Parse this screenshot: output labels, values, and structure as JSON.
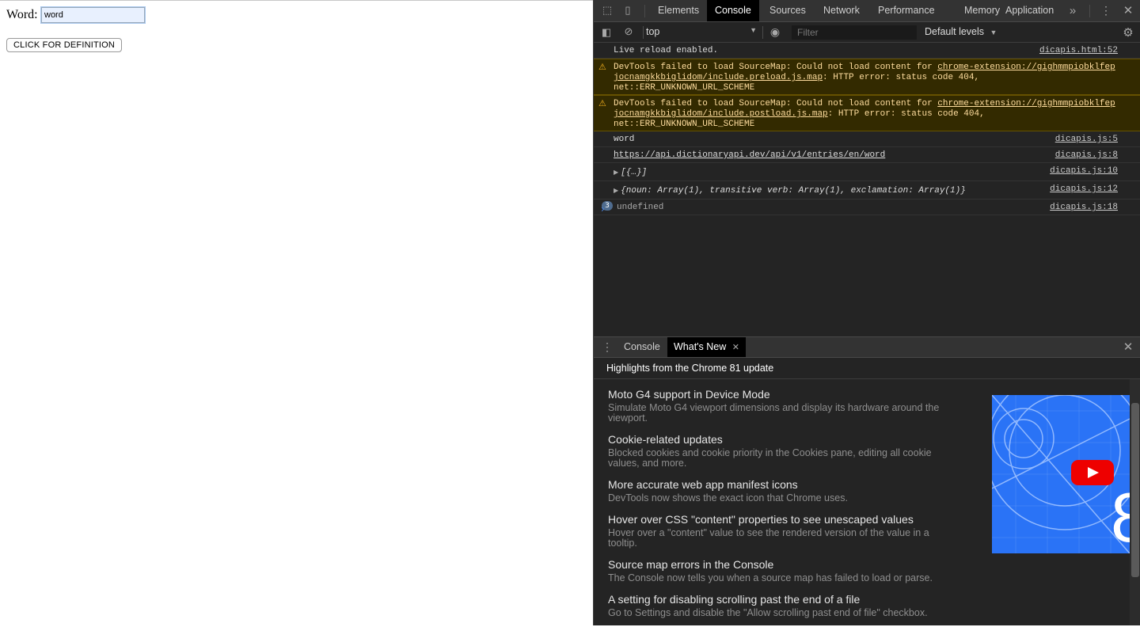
{
  "page": {
    "word_label": "Word:",
    "word_value": "word",
    "button_label": "CLICK FOR DEFINITION"
  },
  "devtools": {
    "tabs": [
      "Elements",
      "Console",
      "Sources",
      "Network",
      "Performance",
      "Memory",
      "Application"
    ],
    "active_tab": "Console",
    "context": "top",
    "filter_placeholder": "Filter",
    "levels": "Default levels",
    "messages": [
      {
        "text": "Live reload enabled.",
        "source": "dicapis.html:52"
      },
      {
        "warn_pre": "DevTools failed to load SourceMap: Could not load content for ",
        "warn_link": "chrome-extension://gighmmpiobklfepjocnamgkkbiglidom/include.preload.js.map",
        "warn_post": ": HTTP error: status code 404, net::ERR_UNKNOWN_URL_SCHEME"
      },
      {
        "warn_pre": "DevTools failed to load SourceMap: Could not load content for ",
        "warn_link": "chrome-extension://gighmmpiobklfepjocnamgkkbiglidom/include.postload.js.map",
        "warn_post": ": HTTP error: status code 404, net::ERR_UNKNOWN_URL_SCHEME"
      },
      {
        "text": "word",
        "source": "dicapis.js:5"
      },
      {
        "text": "https://api.dictionaryapi.dev/api/v1/entries/en/word",
        "source": "dicapis.js:8"
      },
      {
        "text": "[{…}]",
        "source": "dicapis.js:10"
      },
      {
        "text": "{noun: Array(1), transitive verb: Array(1), exclamation: Array(1)}",
        "source": "dicapis.js:12"
      },
      {
        "count": "3",
        "text": "undefined",
        "source": "dicapis.js:18"
      }
    ],
    "drawer": {
      "tabs": [
        "Console",
        "What's New"
      ],
      "active": "What's New",
      "header": "Highlights from the Chrome 81 update",
      "features": [
        {
          "title": "Moto G4 support in Device Mode",
          "desc": "Simulate Moto G4 viewport dimensions and display its hardware around the viewport."
        },
        {
          "title": "Cookie-related updates",
          "desc": "Blocked cookies and cookie priority in the Cookies pane, editing all cookie values, and more."
        },
        {
          "title": "More accurate web app manifest icons",
          "desc": "DevTools now shows the exact icon that Chrome uses."
        },
        {
          "title": "Hover over CSS \"content\" properties to see unescaped values",
          "desc": "Hover over a \"content\" value to see the rendered version of the value in a tooltip."
        },
        {
          "title": "Source map errors in the Console",
          "desc": "The Console now tells you when a source map has failed to load or parse."
        },
        {
          "title": "A setting for disabling scrolling past the end of a file",
          "desc": "Go to Settings and disable the \"Allow scrolling past end of file\" checkbox."
        }
      ]
    },
    "accent": "#4d8ef5",
    "warning_color": "#f2b01e"
  }
}
